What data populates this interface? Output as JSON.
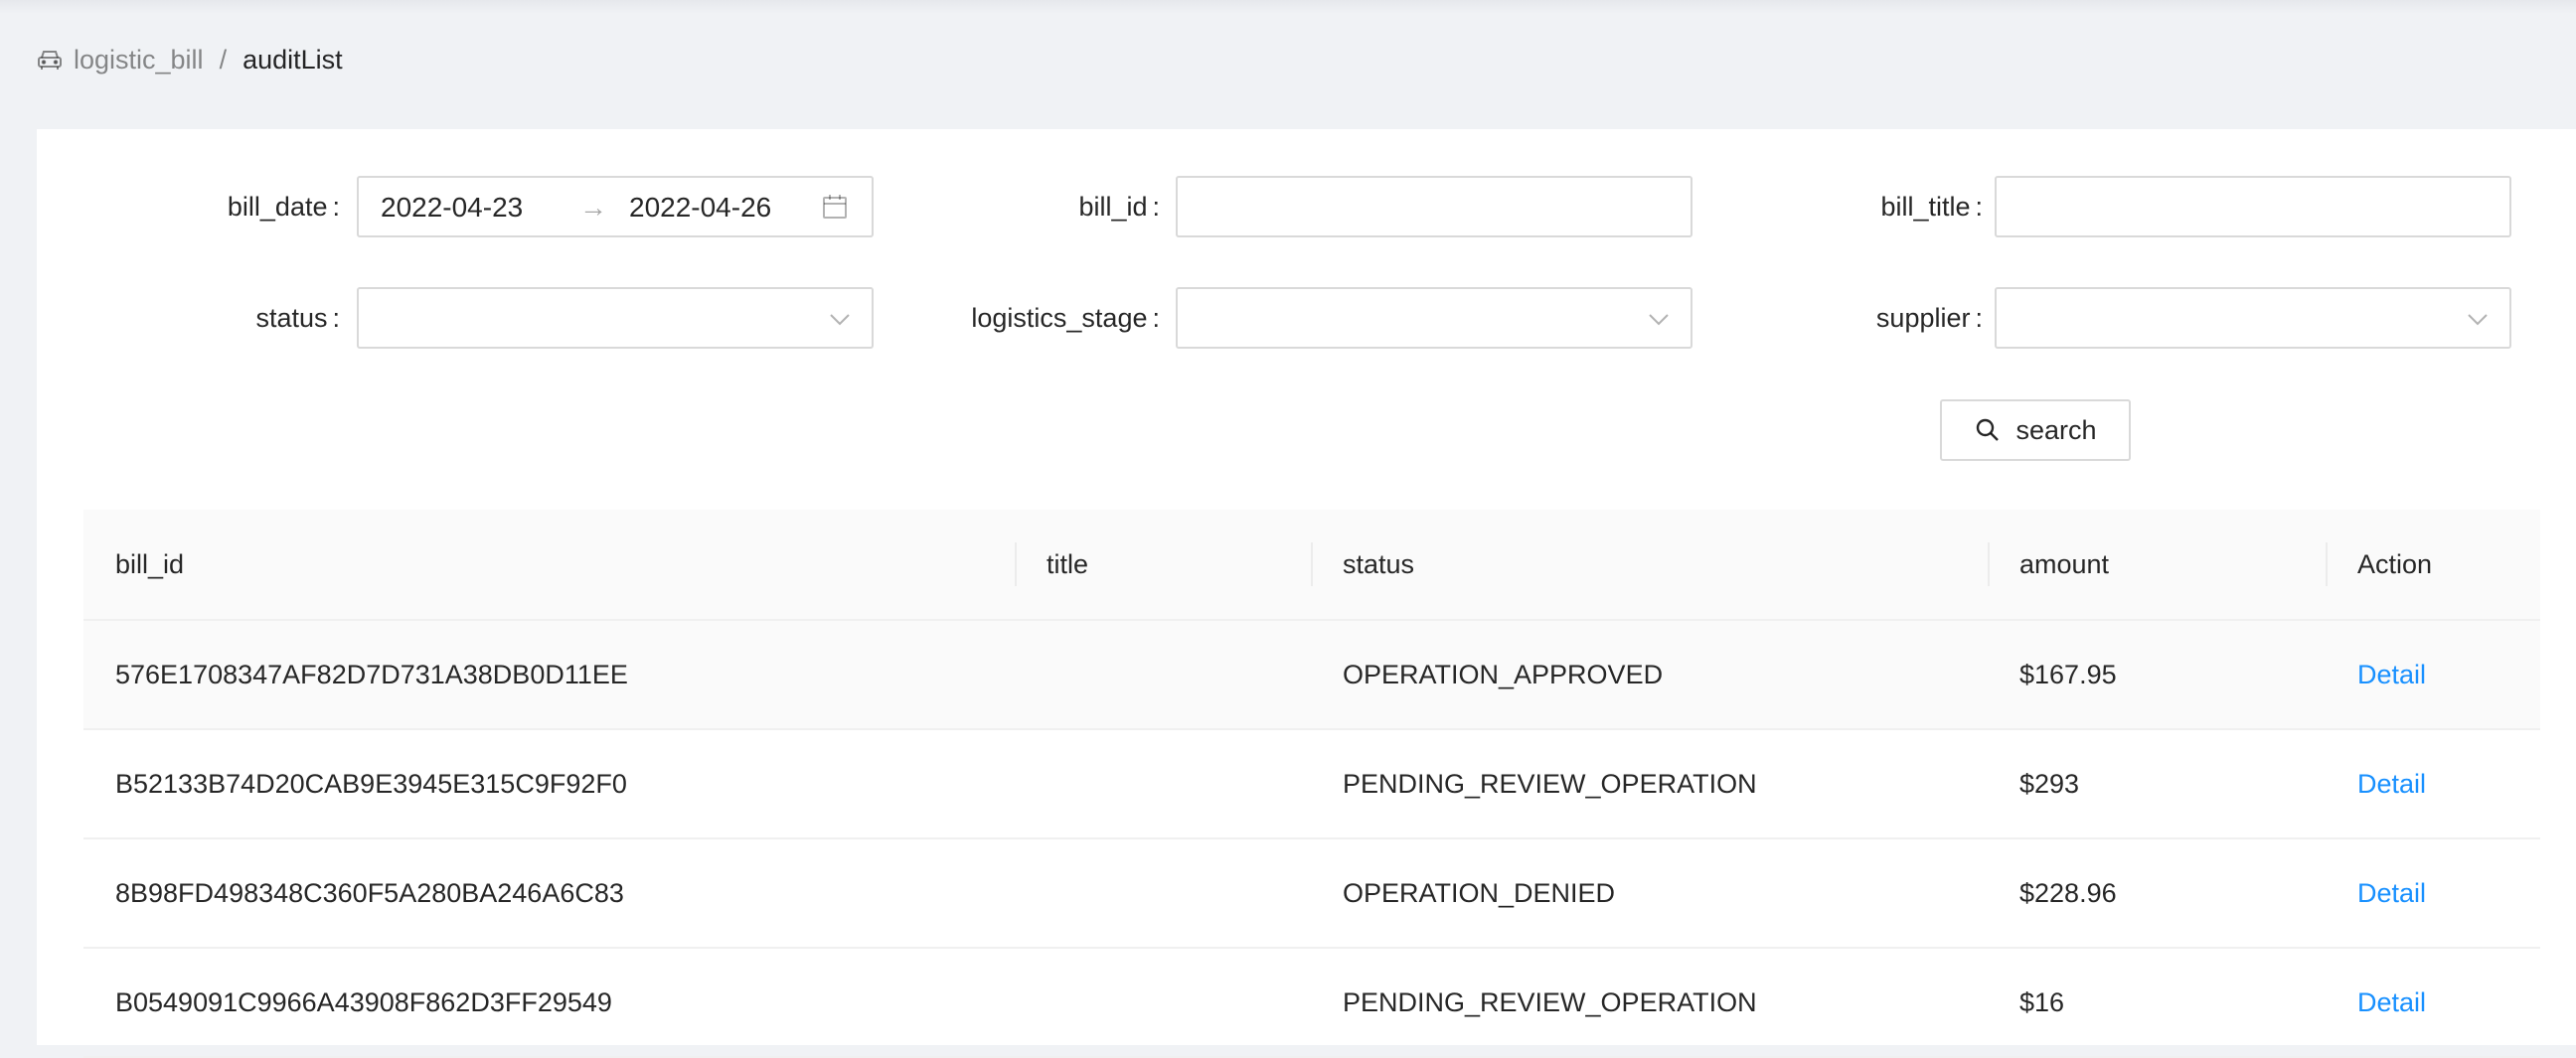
{
  "breadcrumb": {
    "icon": "car-icon",
    "items": [
      "logistic_bill",
      "auditList"
    ],
    "separator": "/"
  },
  "filters": {
    "bill_date": {
      "label": "bill_date",
      "start": "2022-04-23",
      "end": "2022-04-26",
      "arrow": "→"
    },
    "bill_id": {
      "label": "bill_id",
      "value": ""
    },
    "bill_title": {
      "label": "bill_title",
      "value": ""
    },
    "status": {
      "label": "status",
      "value": ""
    },
    "logistics_stage": {
      "label": "logistics_stage",
      "value": ""
    },
    "supplier": {
      "label": "supplier",
      "value": ""
    },
    "colon": ":"
  },
  "search_button": {
    "label": "search",
    "icon": "search-icon"
  },
  "table": {
    "columns": [
      "bill_id",
      "title",
      "status",
      "amount",
      "Action"
    ],
    "rows": [
      {
        "bill_id": "576E1708347AF82D7D731A38DB0D11EE",
        "title": "",
        "status": "OPERATION_APPROVED",
        "amount": "$167.95",
        "action": "Detail"
      },
      {
        "bill_id": "B52133B74D20CAB9E3945E315C9F92F0",
        "title": "",
        "status": "PENDING_REVIEW_OPERATION",
        "amount": "$293",
        "action": "Detail"
      },
      {
        "bill_id": "8B98FD498348C360F5A280BA246A6C83",
        "title": "",
        "status": "OPERATION_DENIED",
        "amount": "$228.96",
        "action": "Detail"
      },
      {
        "bill_id": "B0549091C9966A43908F862D3FF29549",
        "title": "",
        "status": "PENDING_REVIEW_OPERATION",
        "amount": "$16",
        "action": "Detail"
      }
    ]
  },
  "colors": {
    "link": "#1890ff",
    "page_bg": "#f0f2f5",
    "header_bg": "#fafafa"
  }
}
